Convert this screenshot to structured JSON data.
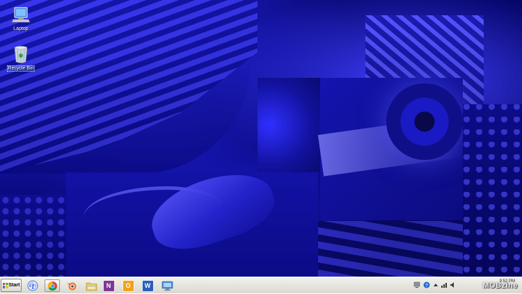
{
  "desktop": {
    "icons": [
      {
        "label": "Laptop",
        "icon": "computer-icon"
      },
      {
        "label": "Recycle Bin",
        "icon": "recycle-bin-icon"
      }
    ]
  },
  "taskbar": {
    "start_label": "Start",
    "pinned": [
      {
        "name": "iTunes",
        "icon": "itunes-icon"
      },
      {
        "name": "Google Chrome",
        "icon": "chrome-icon"
      },
      {
        "name": "Blender",
        "icon": "blender-icon"
      },
      {
        "name": "Windows Explorer",
        "icon": "folder-icon"
      },
      {
        "name": "OneNote",
        "icon": "onenote-icon",
        "glyph": "N"
      },
      {
        "name": "Outlook",
        "icon": "outlook-icon",
        "glyph": "O"
      },
      {
        "name": "Word",
        "icon": "word-icon",
        "glyph": "W"
      },
      {
        "name": "Remote Desktop",
        "icon": "remote-desktop-icon"
      }
    ],
    "tray": {
      "icons": [
        "display-icon",
        "help-icon",
        "show-hidden-icon",
        "network-icon",
        "volume-icon"
      ],
      "clock_time": "9:52 PM",
      "watermark": "MOBzine"
    }
  },
  "colors": {
    "wallpaper_base": "#0a0a8a",
    "taskbar": "#e4e3dc"
  }
}
